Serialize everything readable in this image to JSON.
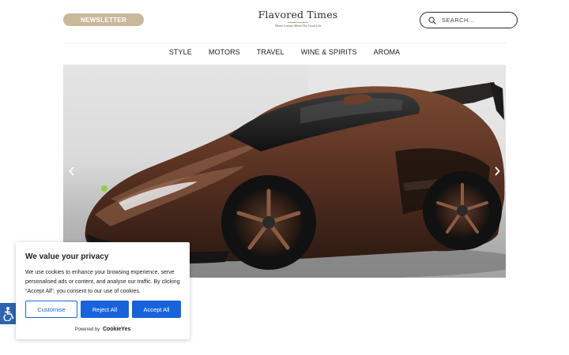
{
  "header": {
    "newsletter_label": "NEWSLETTER",
    "logo_title": "Flavored Times",
    "logo_tagline": "Where Luxury Meets The Good Life",
    "search_placeholder": "SEARCH..."
  },
  "nav": {
    "items": [
      {
        "label": "STYLE"
      },
      {
        "label": "MOTORS"
      },
      {
        "label": "TRAVEL"
      },
      {
        "label": "WINE & SPIRITS"
      },
      {
        "label": "AROMA"
      }
    ]
  },
  "hero": {
    "image_subject": "brown supercar",
    "prev_icon": "chevron-left-icon",
    "next_icon": "chevron-right-icon"
  },
  "accessibility": {
    "icon": "accessibility-icon"
  },
  "cookie_banner": {
    "title": "We value your privacy",
    "text": "We use cookies to enhance your browsing experience, serve personalised ads or content, and analyse our traffic. By clicking \"Accept All\", you consent to our use of cookies.",
    "customise_label": "Customise",
    "reject_label": "Reject All",
    "accept_label": "Accept All",
    "powered_by": "Powered by",
    "brand": "CookieYes"
  },
  "colors": {
    "newsletter_bg": "#c9b99a",
    "cookie_accent": "#1863dc",
    "a11y_bg": "#2c64ad"
  }
}
